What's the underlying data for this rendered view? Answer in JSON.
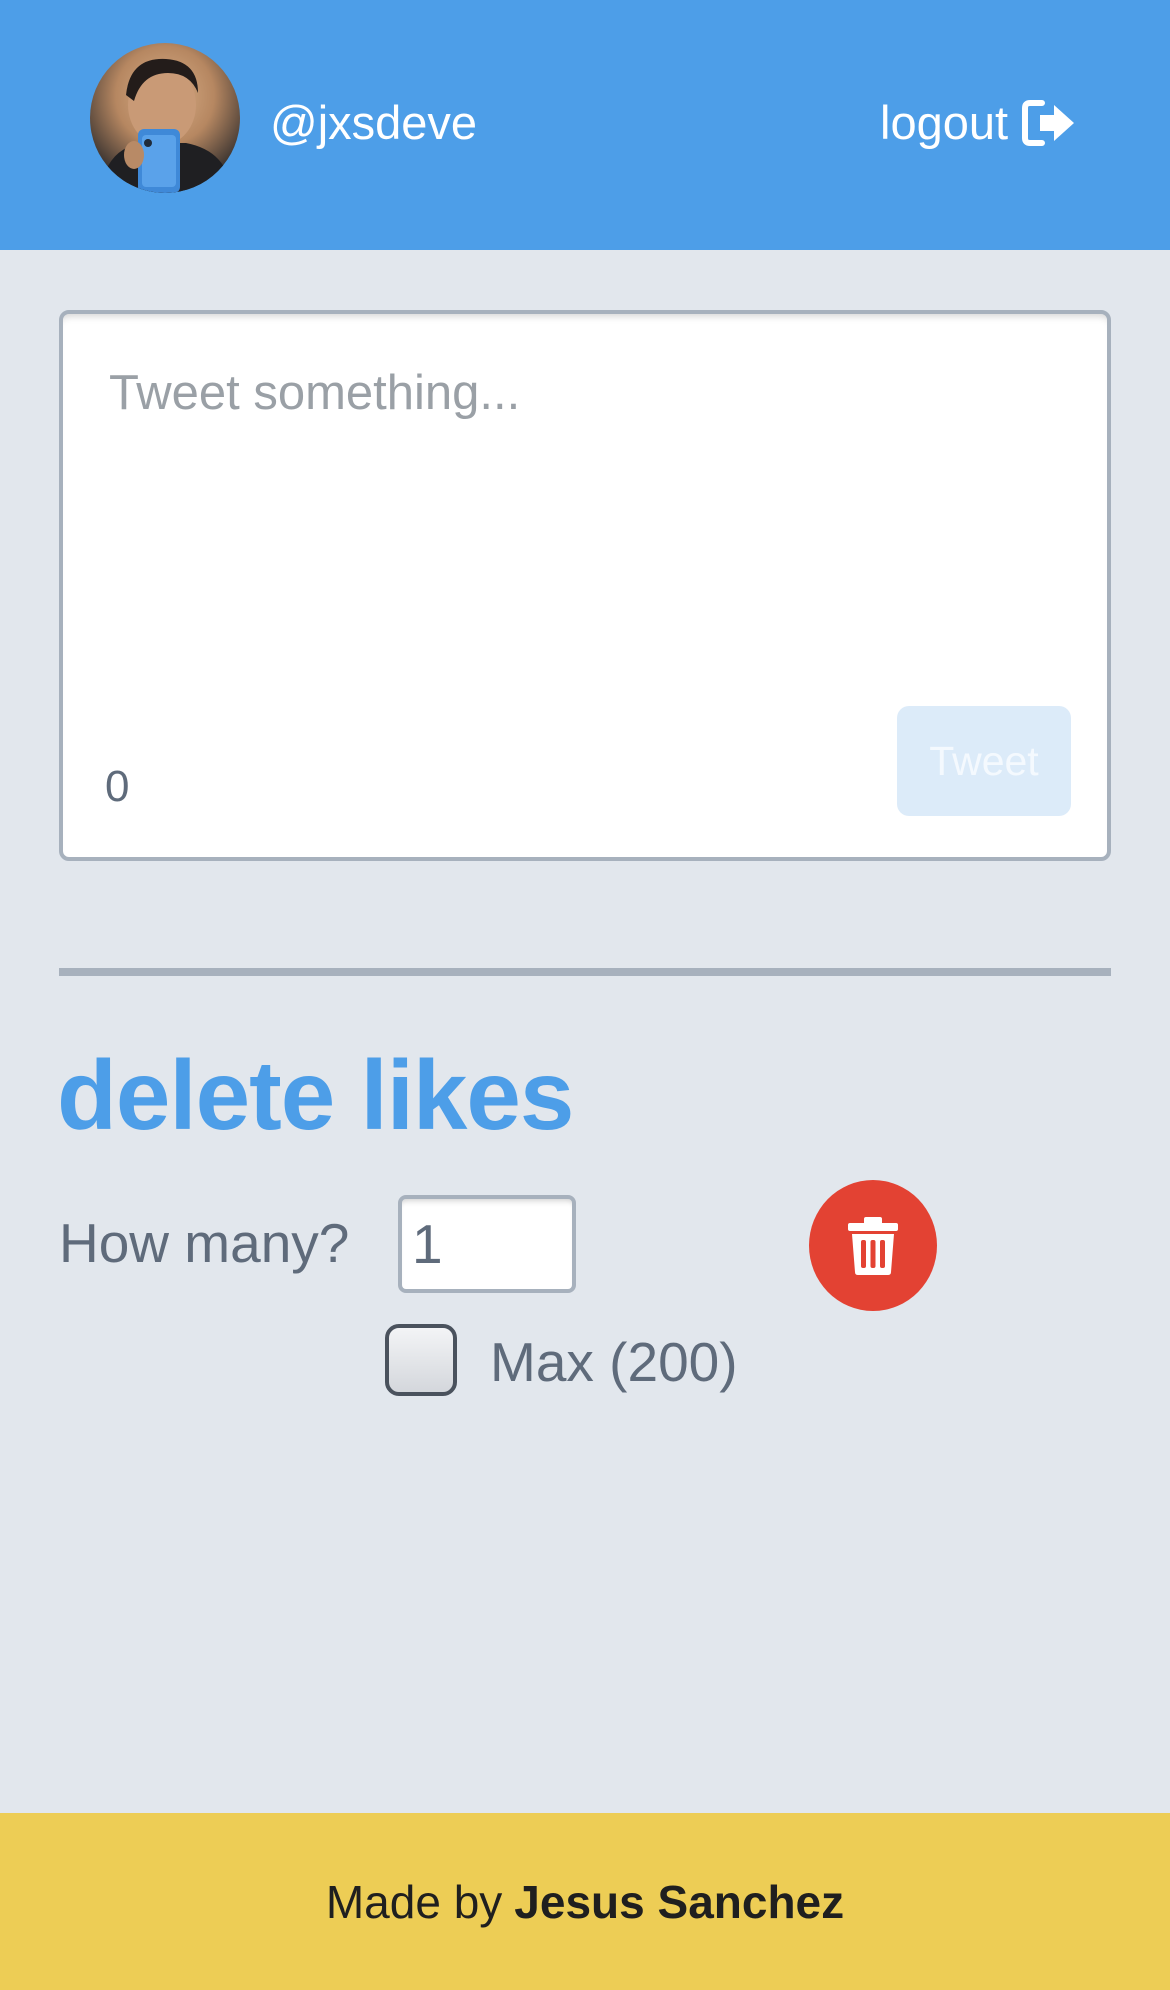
{
  "header": {
    "username": "@jxsdeve",
    "logout_label": "logout",
    "background_color": "#4d9ee8"
  },
  "composer": {
    "placeholder": "Tweet something...",
    "char_count": "0",
    "tweet_button_label": "Tweet",
    "tweet_button_disabled": true
  },
  "delete_likes": {
    "title": "delete likes",
    "how_many_label": "How many?",
    "how_many_value": "1",
    "max_label": "Max (200)",
    "max_checked": false,
    "delete_icon": "trash-icon",
    "delete_button_color": "#e34233"
  },
  "footer": {
    "made_by": "Made by",
    "author": "Jesus Sanchez",
    "background_color": "#edcd55"
  },
  "colors": {
    "accent": "#4d9ee8",
    "page_background": "#e2e7ed",
    "muted_text": "#5f6b7b"
  }
}
